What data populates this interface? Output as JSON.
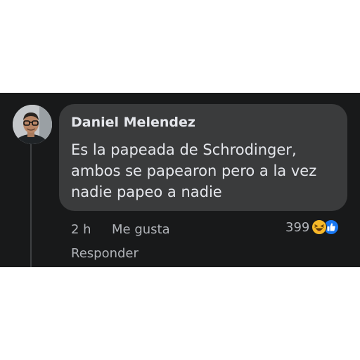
{
  "comment": {
    "author": "Daniel Melendez",
    "lines": [
      "Es la papeada de Schrodinger,",
      "ambos se papearon pero a la vez",
      "nadie papeo a nadie"
    ],
    "time": "2 h",
    "like_label": "Me gusta",
    "reply_label": "Responder",
    "reaction_count": "399",
    "reactions": [
      "haha-icon",
      "like-icon"
    ]
  },
  "colors": {
    "panel_bg": "#18191a",
    "bubble_bg": "#3a3b3c",
    "primary_text": "#e4e6eb",
    "secondary_text": "#b0b3b8",
    "like_blue": "#1877f2",
    "haha_yellow": "#f7b928"
  }
}
